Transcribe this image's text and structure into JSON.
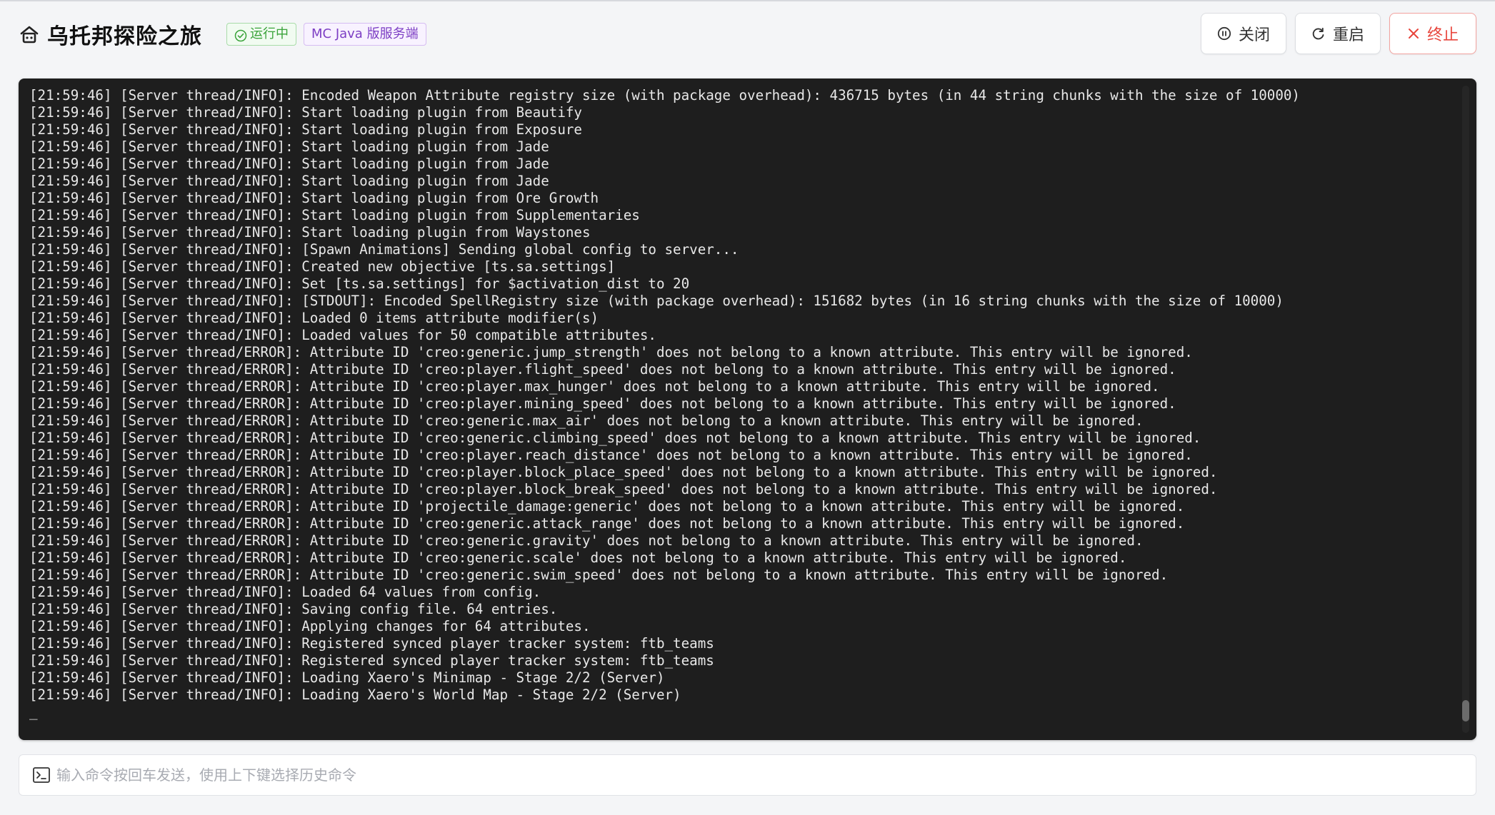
{
  "header": {
    "title": "乌托邦探险之旅",
    "status_badge": "运行中",
    "type_badge": "MC Java 版服务端",
    "icons": {
      "server": "server-icon",
      "status": "check-circle-icon"
    }
  },
  "actions": {
    "close_label": "关闭",
    "restart_label": "重启",
    "kill_label": "终止",
    "icons": {
      "close": "pause-circle-icon",
      "restart": "restart-icon",
      "kill": "close-x-icon"
    }
  },
  "colors": {
    "running": "#3aa33a",
    "type_badge": "#7d3fc4",
    "kill": "#e8453c",
    "console_bg": "#1e1e1e"
  },
  "console": {
    "cursor": "_",
    "lines": [
      "[21:59:46] [Server thread/INFO]: Encoded Weapon Attribute registry size (with package overhead): 436715 bytes (in 44 string chunks with the size of 10000)",
      "[21:59:46] [Server thread/INFO]: Start loading plugin from Beautify",
      "[21:59:46] [Server thread/INFO]: Start loading plugin from Exposure",
      "[21:59:46] [Server thread/INFO]: Start loading plugin from Jade",
      "[21:59:46] [Server thread/INFO]: Start loading plugin from Jade",
      "[21:59:46] [Server thread/INFO]: Start loading plugin from Jade",
      "[21:59:46] [Server thread/INFO]: Start loading plugin from Ore Growth",
      "[21:59:46] [Server thread/INFO]: Start loading plugin from Supplementaries",
      "[21:59:46] [Server thread/INFO]: Start loading plugin from Waystones",
      "[21:59:46] [Server thread/INFO]: [Spawn Animations] Sending global config to server...",
      "[21:59:46] [Server thread/INFO]: Created new objective [ts.sa.settings]",
      "[21:59:46] [Server thread/INFO]: Set [ts.sa.settings] for $activation_dist to 20",
      "[21:59:46] [Server thread/INFO]: [STDOUT]: Encoded SpellRegistry size (with package overhead): 151682 bytes (in 16 string chunks with the size of 10000)",
      "[21:59:46] [Server thread/INFO]: Loaded 0 items attribute modifier(s)",
      "[21:59:46] [Server thread/INFO]: Loaded values for 50 compatible attributes.",
      "[21:59:46] [Server thread/ERROR]: Attribute ID 'creo:generic.jump_strength' does not belong to a known attribute. This entry will be ignored.",
      "[21:59:46] [Server thread/ERROR]: Attribute ID 'creo:player.flight_speed' does not belong to a known attribute. This entry will be ignored.",
      "[21:59:46] [Server thread/ERROR]: Attribute ID 'creo:player.max_hunger' does not belong to a known attribute. This entry will be ignored.",
      "[21:59:46] [Server thread/ERROR]: Attribute ID 'creo:player.mining_speed' does not belong to a known attribute. This entry will be ignored.",
      "[21:59:46] [Server thread/ERROR]: Attribute ID 'creo:generic.max_air' does not belong to a known attribute. This entry will be ignored.",
      "[21:59:46] [Server thread/ERROR]: Attribute ID 'creo:generic.climbing_speed' does not belong to a known attribute. This entry will be ignored.",
      "[21:59:46] [Server thread/ERROR]: Attribute ID 'creo:player.reach_distance' does not belong to a known attribute. This entry will be ignored.",
      "[21:59:46] [Server thread/ERROR]: Attribute ID 'creo:player.block_place_speed' does not belong to a known attribute. This entry will be ignored.",
      "[21:59:46] [Server thread/ERROR]: Attribute ID 'creo:player.block_break_speed' does not belong to a known attribute. This entry will be ignored.",
      "[21:59:46] [Server thread/ERROR]: Attribute ID 'projectile_damage:generic' does not belong to a known attribute. This entry will be ignored.",
      "[21:59:46] [Server thread/ERROR]: Attribute ID 'creo:generic.attack_range' does not belong to a known attribute. This entry will be ignored.",
      "[21:59:46] [Server thread/ERROR]: Attribute ID 'creo:generic.gravity' does not belong to a known attribute. This entry will be ignored.",
      "[21:59:46] [Server thread/ERROR]: Attribute ID 'creo:generic.scale' does not belong to a known attribute. This entry will be ignored.",
      "[21:59:46] [Server thread/ERROR]: Attribute ID 'creo:generic.swim_speed' does not belong to a known attribute. This entry will be ignored.",
      "[21:59:46] [Server thread/INFO]: Loaded 64 values from config.",
      "[21:59:46] [Server thread/INFO]: Saving config file. 64 entries.",
      "[21:59:46] [Server thread/INFO]: Applying changes for 64 attributes.",
      "[21:59:46] [Server thread/INFO]: Registered synced player tracker system: ftb_teams",
      "[21:59:46] [Server thread/INFO]: Registered synced player tracker system: ftb_teams",
      "[21:59:46] [Server thread/INFO]: Loading Xaero's Minimap - Stage 2/2 (Server)",
      "[21:59:46] [Server thread/INFO]: Loading Xaero's World Map - Stage 2/2 (Server)"
    ]
  },
  "command": {
    "placeholder": "输入命令按回车发送，使用上下键选择历史命令",
    "value": "",
    "icon": "terminal-icon"
  }
}
